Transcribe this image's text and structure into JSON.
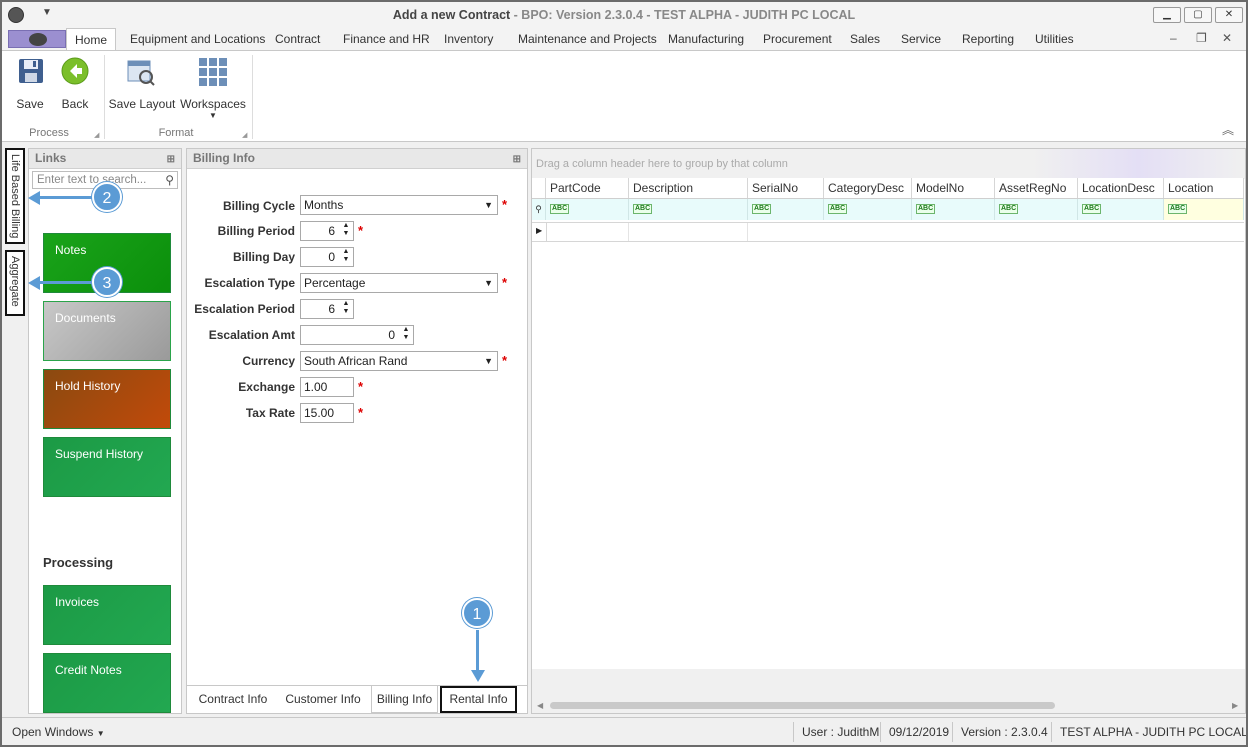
{
  "window": {
    "title_main": "Add a new Contract",
    "title_rest": " - BPO: Version 2.3.0.4 - TEST ALPHA - JUDITH PC LOCAL"
  },
  "ribbon": {
    "tabs": [
      "Home",
      "Equipment and Locations",
      "Contract",
      "Finance and HR",
      "Inventory",
      "Maintenance and Projects",
      "Manufacturing",
      "Procurement",
      "Sales",
      "Service",
      "Reporting",
      "Utilities"
    ],
    "active_tab": "Home",
    "process_group": "Process",
    "format_group": "Format",
    "save_label": "Save",
    "back_label": "Back",
    "save_layout_label": "Save Layout",
    "workspaces_label": "Workspaces"
  },
  "side_tabs": {
    "life_based_billing": "Life Based Billing",
    "aggregate": "Aggregate"
  },
  "links": {
    "title": "Links",
    "search_placeholder": "Enter text to search...",
    "tiles": [
      {
        "label": "Notes",
        "color": "#16a516"
      },
      {
        "label": "Documents",
        "color": "#b0b0b0"
      },
      {
        "label": "Hold History",
        "color": "#b5470f"
      },
      {
        "label": "Suspend History",
        "color": "#1fa24c"
      }
    ],
    "processing_title": "Processing",
    "processing_tiles": [
      {
        "label": "Invoices",
        "color": "#1fa24c"
      },
      {
        "label": "Credit Notes",
        "color": "#1fa24c"
      }
    ]
  },
  "billing": {
    "title": "Billing Info",
    "fields": {
      "billing_cycle": {
        "label": "Billing Cycle",
        "value": "Months"
      },
      "billing_period": {
        "label": "Billing Period",
        "value": "6"
      },
      "billing_day": {
        "label": "Billing Day",
        "value": "0"
      },
      "escalation_type": {
        "label": "Escalation Type",
        "value": "Percentage"
      },
      "escalation_period": {
        "label": "Escalation Period",
        "value": "6"
      },
      "escalation_amt": {
        "label": "Escalation Amt",
        "value": "0"
      },
      "currency": {
        "label": "Currency",
        "value": "South African Rand"
      },
      "exchange": {
        "label": "Exchange",
        "value": "1.00"
      },
      "tax_rate": {
        "label": "Tax Rate",
        "value": "15.00"
      }
    },
    "required_mark": "*",
    "bottom_tabs": [
      "Contract Info",
      "Customer Info",
      "Billing Info",
      "Rental Info"
    ]
  },
  "grid": {
    "group_hint": "Drag a column header here to group by that column",
    "columns": [
      "PartCode",
      "Description",
      "SerialNo",
      "CategoryDesc",
      "ModelNo",
      "AssetRegNo",
      "LocationDesc",
      "Location"
    ],
    "filter_icon": "abc-filter-icon"
  },
  "callouts": [
    "1",
    "2",
    "3"
  ],
  "status": {
    "open_windows": "Open Windows",
    "user": "User : JudithM",
    "date": "09/12/2019",
    "version": "Version : 2.3.0.4",
    "environment": "TEST ALPHA - JUDITH PC LOCAL"
  },
  "colors": {
    "callout": "#5b9bd5",
    "required": "#dd0000",
    "filter_row": "#e8fbfb"
  }
}
